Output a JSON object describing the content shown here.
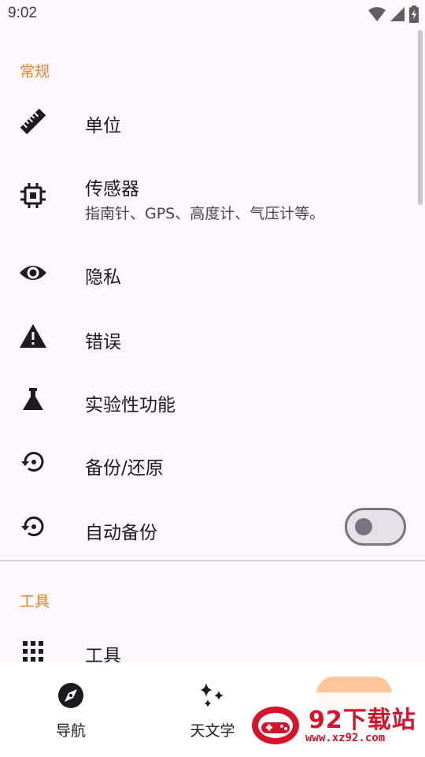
{
  "status_bar": {
    "time": "9:02",
    "icons": [
      "wifi-icon",
      "cell-signal-icon",
      "battery-charging-icon"
    ]
  },
  "sections": {
    "general": "常规",
    "tools": "工具"
  },
  "preferences": {
    "units": {
      "title": "单位",
      "icon": "ruler-icon"
    },
    "sensors": {
      "title": "传感器",
      "summary": "指南针、GPS、高度计、气压计等。",
      "icon": "chip-icon"
    },
    "privacy": {
      "title": "隐私",
      "icon": "eye-icon"
    },
    "errors": {
      "title": "错误",
      "icon": "warning-icon"
    },
    "experimental": {
      "title": "实验性功能",
      "icon": "flask-icon"
    },
    "backup_restore": {
      "title": "备份/还原",
      "icon": "backup-restore-icon"
    },
    "auto_backup": {
      "title": "自动备份",
      "icon": "backup-restore-icon",
      "enabled": false
    },
    "tools": {
      "title": "工具",
      "icon": "grid-icon"
    }
  },
  "bottom_nav": {
    "items": [
      {
        "label": "导航",
        "icon": "compass-icon"
      },
      {
        "label": "天文学",
        "icon": "sparkles-icon"
      }
    ]
  },
  "watermark": {
    "brand": "92下载站",
    "url": "www.xz92.com"
  },
  "colors": {
    "accent": "#e1852c",
    "background": "#fdf7fd",
    "nav_pill": "#ffc799",
    "watermark": "#d4142a"
  }
}
